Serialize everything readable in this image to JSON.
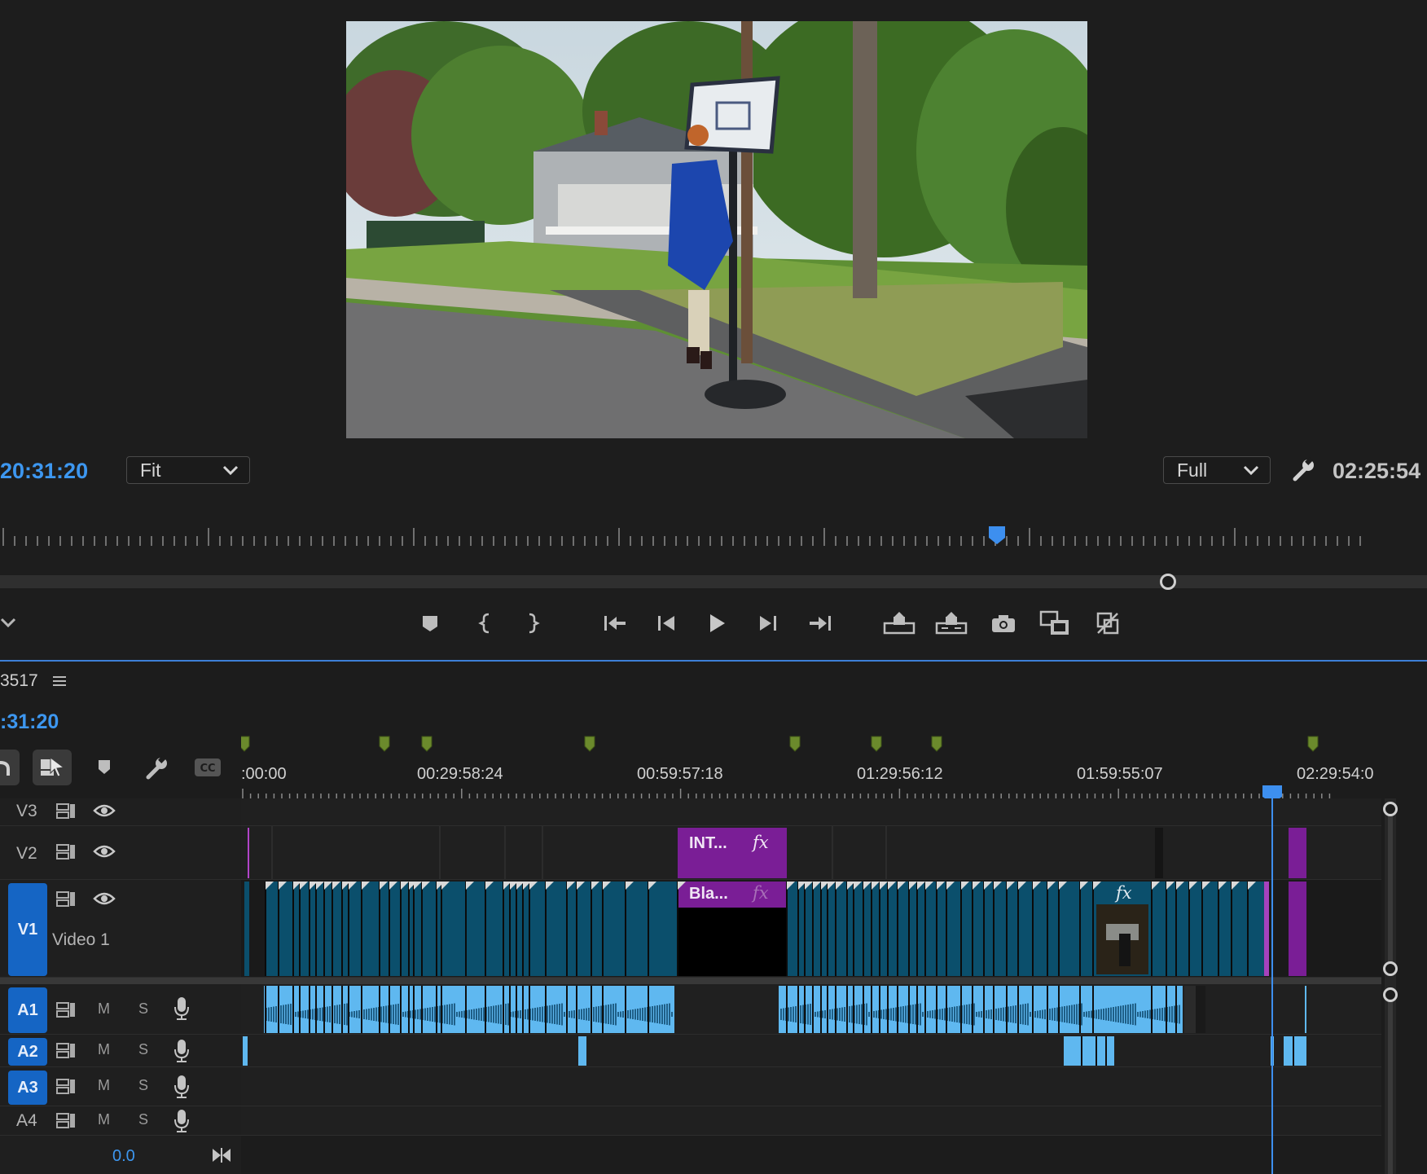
{
  "monitor": {
    "timecode_left": "20:31:20",
    "timecode_right": "02:25:54",
    "zoom_dropdown": "Fit",
    "resolution_dropdown": "Full"
  },
  "transport": {
    "buttons": [
      {
        "name": "add-marker-button",
        "icon": "marker-icon"
      },
      {
        "name": "mark-in-button",
        "icon": "mark-in-icon"
      },
      {
        "name": "mark-out-button",
        "icon": "mark-out-icon"
      },
      {
        "name": "go-to-in-button",
        "icon": "go-to-in-icon"
      },
      {
        "name": "step-back-button",
        "icon": "step-back-icon"
      },
      {
        "name": "play-button",
        "icon": "play-icon"
      },
      {
        "name": "step-forward-button",
        "icon": "step-forward-icon"
      },
      {
        "name": "go-to-out-button",
        "icon": "go-to-out-icon"
      },
      {
        "name": "lift-button",
        "icon": "lift-icon"
      },
      {
        "name": "extract-button",
        "icon": "extract-icon"
      },
      {
        "name": "export-frame-button",
        "icon": "camera-icon"
      },
      {
        "name": "insert-button",
        "icon": "insert-icon"
      },
      {
        "name": "overwrite-button",
        "icon": "overwrite-icon"
      }
    ]
  },
  "timeline": {
    "sequence_name": "3517",
    "timecode": ":31:20",
    "ruler_labels": [
      ":00:00",
      "00:29:58:24",
      "00:59:57:18",
      "01:29:56:12",
      "01:59:55:07",
      "02:29:54:0"
    ],
    "tracks": {
      "v3": "V3",
      "v2": "V2",
      "v1": "V1",
      "v1_name": "Video 1",
      "a1": "A1",
      "a2": "A2",
      "a3": "A3",
      "a4": "A4",
      "mute": "M",
      "solo": "S"
    },
    "clips": {
      "v2_title": "INT...",
      "v1_black": "Bla...",
      "fx": "fx"
    },
    "volume": "0.0"
  },
  "colors": {
    "accent": "#3d97f0",
    "video_clip": "#0b4f6c",
    "audio_clip": "#5fb8f0",
    "title_clip": "#7a1e96",
    "track_target": "#1565c4",
    "work_area": "#e5d82b",
    "marker": "#6b8a2c"
  }
}
